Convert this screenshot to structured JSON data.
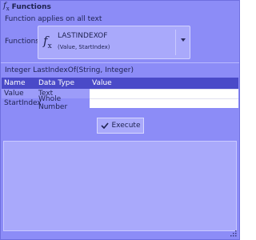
{
  "header": {
    "icon": "function-icon",
    "title": "Functions"
  },
  "subtitle": "Function applies on all text",
  "functions": {
    "label": "Functions",
    "selected_name": "LASTINDEXOF",
    "selected_params": "(Value, StartIndex)"
  },
  "signature": "Integer LastIndexOf(String, Integer)",
  "grid": {
    "columns": [
      "Name",
      "Data Type",
      "Value"
    ],
    "rows": [
      {
        "name": "Value",
        "type": "Text",
        "value": ""
      },
      {
        "name": "StartIndex",
        "type": "Whole Number",
        "value": ""
      }
    ]
  },
  "execute": {
    "label": "Execute",
    "icon": "checkmark-icon"
  },
  "output": "",
  "colors": {
    "panel_bg": "#8c8cf7",
    "grid_header_bg": "#4a4ac8",
    "text": "#1e2250"
  }
}
